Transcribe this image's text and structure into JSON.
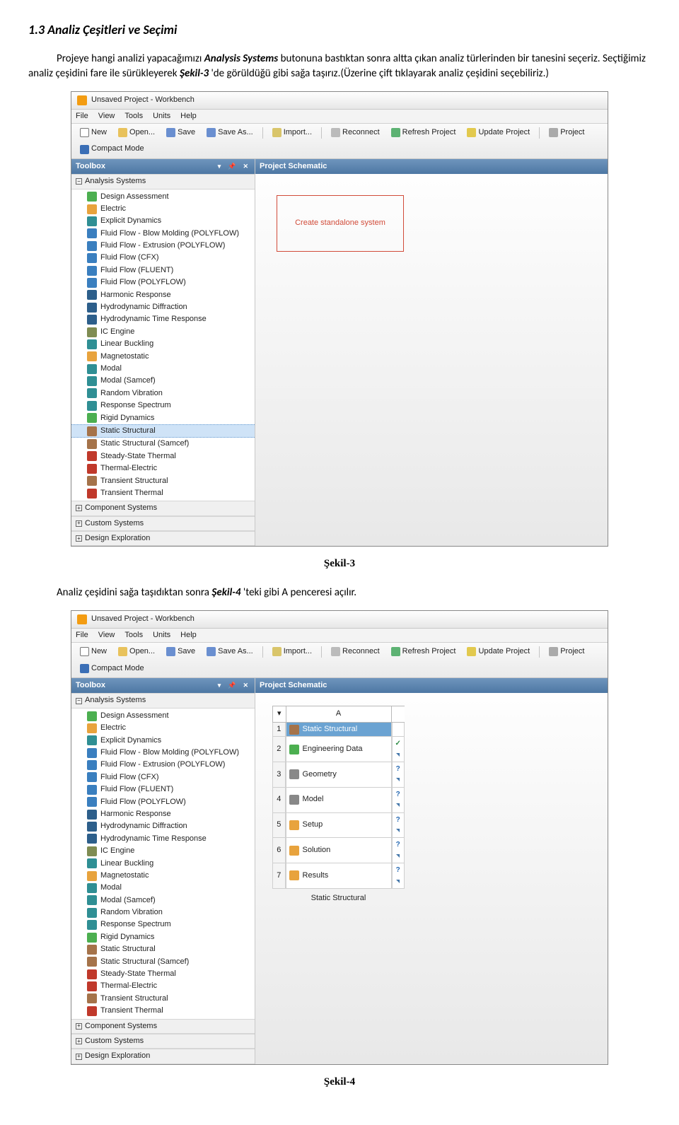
{
  "heading": "1.3 Analiz Çeşitleri ve Seçimi",
  "para_pre": "Projeye hangi analizi yapacağımızı ",
  "para_as": "Analysis Systems",
  "para_mid": " butonuna bastıktan sonra altta çıkan analiz türlerinden bir tanesini seçeriz. Seçtiğimiz analiz çeşidini fare ile sürükleyerek ",
  "para_sek": "Şekil-3",
  "para_post": " 'de görüldüğü gibi sağa taşırız.(Üzerine çift tıklayarak analiz çeşidini seçebiliriz.)",
  "window_title": "Unsaved Project - Workbench",
  "menu": {
    "file": "File",
    "view": "View",
    "tools": "Tools",
    "units": "Units",
    "help": "Help"
  },
  "tb": {
    "new": "New",
    "open": "Open...",
    "save": "Save",
    "saveas": "Save As...",
    "import": "Import...",
    "reconnect": "Reconnect",
    "refresh": "Refresh Project",
    "update": "Update Project",
    "project": "Project",
    "compact": "Compact Mode"
  },
  "toolbox_title": "Toolbox",
  "schematic_title": "Project Schematic",
  "cat_as": "Analysis Systems",
  "cat_cs": "Component Systems",
  "cat_cus": "Custom Systems",
  "cat_de": "Design Exploration",
  "dropzone": "Create standalone system",
  "items": [
    {
      "label": "Design Assessment",
      "ic": "ic-green"
    },
    {
      "label": "Electric",
      "ic": "ic-orange"
    },
    {
      "label": "Explicit Dynamics",
      "ic": "ic-teal"
    },
    {
      "label": "Fluid Flow - Blow Molding (POLYFLOW)",
      "ic": "ic-blue"
    },
    {
      "label": "Fluid Flow - Extrusion (POLYFLOW)",
      "ic": "ic-blue"
    },
    {
      "label": "Fluid Flow (CFX)",
      "ic": "ic-blue"
    },
    {
      "label": "Fluid Flow (FLUENT)",
      "ic": "ic-blue"
    },
    {
      "label": "Fluid Flow (POLYFLOW)",
      "ic": "ic-blue"
    },
    {
      "label": "Harmonic Response",
      "ic": "ic-navy"
    },
    {
      "label": "Hydrodynamic Diffraction",
      "ic": "ic-navy"
    },
    {
      "label": "Hydrodynamic Time Response",
      "ic": "ic-navy"
    },
    {
      "label": "IC Engine",
      "ic": "ic-olive"
    },
    {
      "label": "Linear Buckling",
      "ic": "ic-teal"
    },
    {
      "label": "Magnetostatic",
      "ic": "ic-orange"
    },
    {
      "label": "Modal",
      "ic": "ic-teal"
    },
    {
      "label": "Modal (Samcef)",
      "ic": "ic-teal"
    },
    {
      "label": "Random Vibration",
      "ic": "ic-teal"
    },
    {
      "label": "Response Spectrum",
      "ic": "ic-teal"
    },
    {
      "label": "Rigid Dynamics",
      "ic": "ic-green"
    },
    {
      "label": "Static Structural",
      "ic": "ic-brown",
      "selected": true
    },
    {
      "label": "Static Structural (Samcef)",
      "ic": "ic-brown"
    },
    {
      "label": "Steady-State Thermal",
      "ic": "ic-red"
    },
    {
      "label": "Thermal-Electric",
      "ic": "ic-red"
    },
    {
      "label": "Transient Structural",
      "ic": "ic-brown"
    },
    {
      "label": "Transient Thermal",
      "ic": "ic-red"
    }
  ],
  "fig3": "Şekil-3",
  "after_pre": "Analiz çeşidini sağa taşıdıktan sonra ",
  "after_sek": "Şekil-4",
  "after_post": " 'teki gibi A penceresi açılır.",
  "sys": {
    "col": "A",
    "caption": "Static Structural",
    "rows": [
      {
        "n": "1",
        "label": "Static Structural",
        "ic": "ic-brown",
        "stat": ""
      },
      {
        "n": "2",
        "label": "Engineering Data",
        "ic": "ic-green",
        "stat": "chk"
      },
      {
        "n": "3",
        "label": "Geometry",
        "ic": "ic-grey",
        "stat": "qm"
      },
      {
        "n": "4",
        "label": "Model",
        "ic": "ic-grey",
        "stat": "qm"
      },
      {
        "n": "5",
        "label": "Setup",
        "ic": "ic-orange",
        "stat": "qm"
      },
      {
        "n": "6",
        "label": "Solution",
        "ic": "ic-orange",
        "stat": "qm"
      },
      {
        "n": "7",
        "label": "Results",
        "ic": "ic-orange",
        "stat": "qm"
      }
    ]
  },
  "fig4": "Şekil-4"
}
